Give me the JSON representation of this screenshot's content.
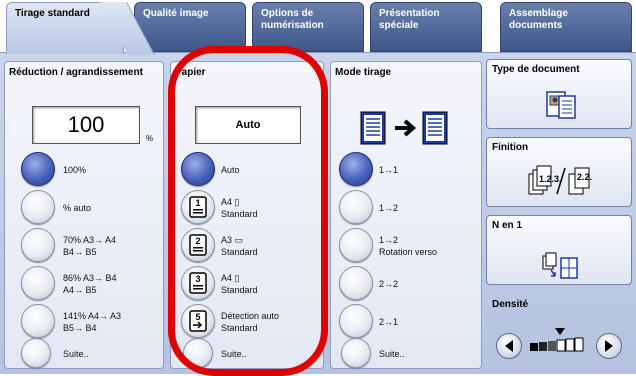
{
  "tabs": [
    {
      "label": "Tirage standard"
    },
    {
      "label": "Qualité image"
    },
    {
      "label": "Options de numérisation"
    },
    {
      "label": "Présentation spéciale"
    },
    {
      "label": "Assemblage documents"
    }
  ],
  "reduction": {
    "title": "Réduction / agrandissement",
    "value": "100",
    "unit": "%",
    "options": [
      {
        "label": "100%",
        "selected": true
      },
      {
        "label": "% auto"
      },
      {
        "label": "70% A3→ A4\nB4→ B5"
      },
      {
        "label": "86% A3→ B4\nA4→ B5"
      },
      {
        "label": "141% A4→ A3\nB5→ B4"
      },
      {
        "label": "Suite.."
      }
    ]
  },
  "paper": {
    "title": "Papier",
    "value": "Auto",
    "options": [
      {
        "label": "Auto",
        "selected": true
      },
      {
        "label": "A4 ▯\nStandard",
        "tray": "1"
      },
      {
        "label": "A3 ▭\nStandard",
        "tray": "2"
      },
      {
        "label": "A4 ▯\nStandard",
        "tray": "3"
      },
      {
        "label": "Détection auto\nStandard",
        "tray": "5"
      },
      {
        "label": "Suite.."
      }
    ]
  },
  "mode": {
    "title": "Mode tirage",
    "options": [
      {
        "label": "1→1",
        "selected": true
      },
      {
        "label": "1→2"
      },
      {
        "label": "1→2\nRotation verso"
      },
      {
        "label": "2→2"
      },
      {
        "label": "2→1"
      },
      {
        "label": "Suite.."
      }
    ]
  },
  "right": {
    "doc_type": "Type de document",
    "finishing": "Finition",
    "n_up": "N en 1",
    "density": "Densité"
  },
  "colors": {
    "accent": "#3f5689",
    "highlight": "#e00000"
  }
}
